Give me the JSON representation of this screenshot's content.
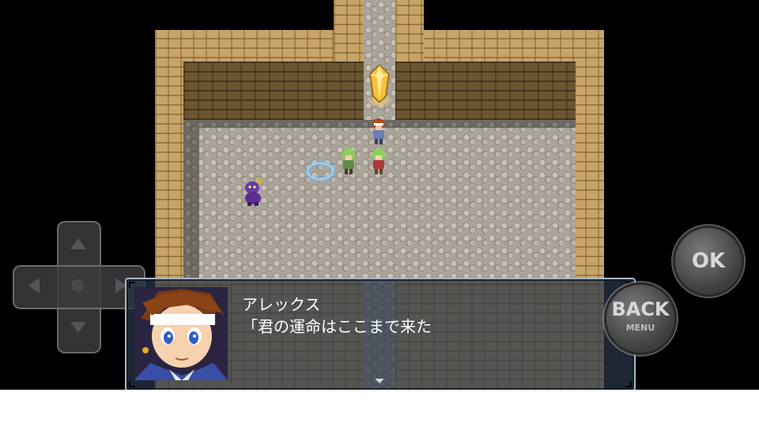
{
  "dialogue": {
    "speaker": "アレックス",
    "line": "「君の運命はここまで来た"
  },
  "controls": {
    "ok_label": "OK",
    "back_label": "BACK",
    "back_sub_label": "MENU"
  },
  "icons": {
    "dpad": "dpad-icon",
    "crystal": "crystal-icon",
    "magic_circle": "magic-circle-icon",
    "pause": "triangle-down-icon"
  },
  "colors": {
    "wall": "#c7a468",
    "dark_wall": "#6b5531",
    "floor": "#aaa49a",
    "window": "#28344a",
    "window_border": "#a9b6c6",
    "text": "#ffffff"
  }
}
